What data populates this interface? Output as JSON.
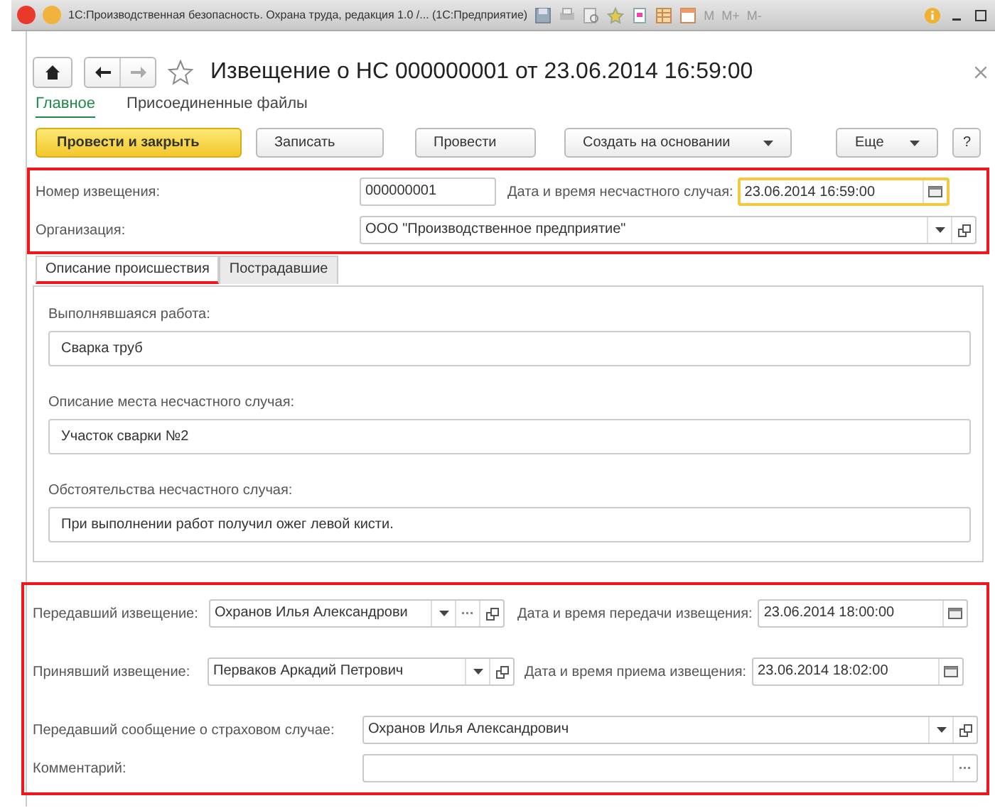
{
  "title_bar": {
    "title": "1С:Производственная безопасность. Охрана труда, редакция 1.0 /... (1С:Предприятие)",
    "memory_buttons": [
      "M",
      "M+",
      "M-"
    ]
  },
  "form": {
    "title": "Извещение о НС 000000001 от 23.06.2014 16:59:00"
  },
  "sections": [
    {
      "label": "Главное",
      "selected": true
    },
    {
      "label": "Присоединенные файлы",
      "selected": false
    }
  ],
  "toolbar": [
    {
      "label": "Провести и закрыть",
      "kind": "primary"
    },
    {
      "label": "Записать",
      "kind": "plain"
    },
    {
      "label": "Провести",
      "kind": "plain"
    },
    {
      "label": "Создать на основании",
      "kind": "menu"
    },
    {
      "label": "Еще",
      "kind": "menu"
    },
    {
      "label": "?",
      "kind": "help"
    }
  ],
  "header_fields": [
    {
      "label": "Номер извещения:",
      "value": "000000001",
      "focused": false
    },
    {
      "label": "Дата и время несчастного случая:",
      "value": "23.06.2014 16:59:00",
      "buttons": [
        {
          "kind": "calendar"
        }
      ],
      "focused": true
    },
    {
      "label": "Организация:",
      "value": "ООО \"Производственное предприятие\"",
      "buttons": [
        {
          "kind": "dropdown"
        },
        {
          "kind": "open"
        }
      ],
      "focused": false
    }
  ],
  "tabs": [
    {
      "label": "Описание происшествия",
      "selected": true
    },
    {
      "label": "Пострадавшие",
      "selected": false
    }
  ],
  "description_fields": [
    {
      "label": "Выполнявшаяся работа:",
      "value": "Сварка труб"
    },
    {
      "label": "Описание места несчастного случая:",
      "value": "Участок сварки №2"
    },
    {
      "label": "Обстоятельства несчастного случая:",
      "value": "При выполнении работ получил ожег левой кисти."
    }
  ],
  "footer_fields": [
    {
      "label": "Передавший извещение:",
      "value": "Охранов Илья Александрови",
      "buttons": [
        {
          "kind": "dropdown"
        },
        {
          "kind": "choose"
        },
        {
          "kind": "open"
        }
      ]
    },
    {
      "label": "Дата и время передачи извещения:",
      "value": "23.06.2014 18:00:00",
      "buttons": [
        {
          "kind": "calendar"
        }
      ]
    },
    {
      "label": "Принявший извещение:",
      "value": "Перваков Аркадий Петрович",
      "buttons": [
        {
          "kind": "dropdown"
        },
        {
          "kind": "open"
        }
      ]
    },
    {
      "label": "Дата и время приема извещения:",
      "value": "23.06.2014 18:02:00",
      "buttons": [
        {
          "kind": "calendar"
        }
      ]
    },
    {
      "label": "Передавший сообщение о страховом случае:",
      "value": "Охранов Илья Александрович",
      "buttons": [
        {
          "kind": "dropdown"
        },
        {
          "kind": "open"
        }
      ]
    },
    {
      "label": "Комментарий:",
      "buttons": [
        {
          "kind": "choose"
        }
      ]
    }
  ]
}
